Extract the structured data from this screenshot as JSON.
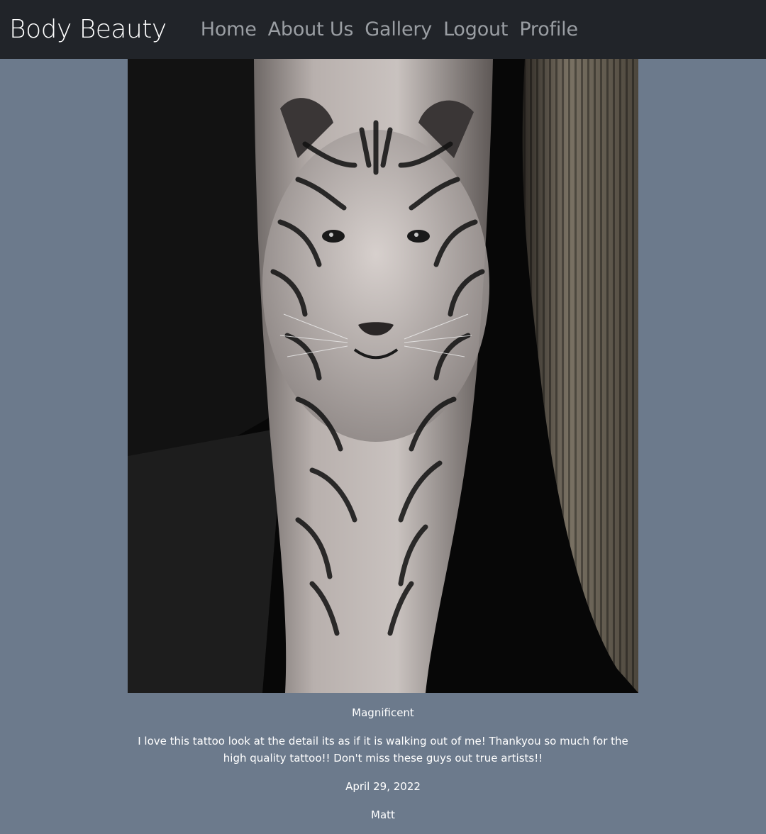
{
  "navbar": {
    "brand": "Body Beauty",
    "links": [
      {
        "label": "Home"
      },
      {
        "label": "About Us"
      },
      {
        "label": "Gallery"
      },
      {
        "label": "Logout"
      },
      {
        "label": "Profile"
      }
    ]
  },
  "post": {
    "image_icon": "tiger-forearm-tattoo-photo",
    "title": "Magnificent",
    "review": "I love this tattoo look at the detail its as if it is walking out of me! Thankyou so much for the high quality tattoo!! Don't miss these guys out true artists!!",
    "date": "April 29, 2022",
    "author": "Matt"
  },
  "colors": {
    "page_background": "#6c7a8c",
    "navbar_background": "#212429",
    "brand_text": "#ffffff",
    "nav_link_text": "#9a9ea3"
  }
}
